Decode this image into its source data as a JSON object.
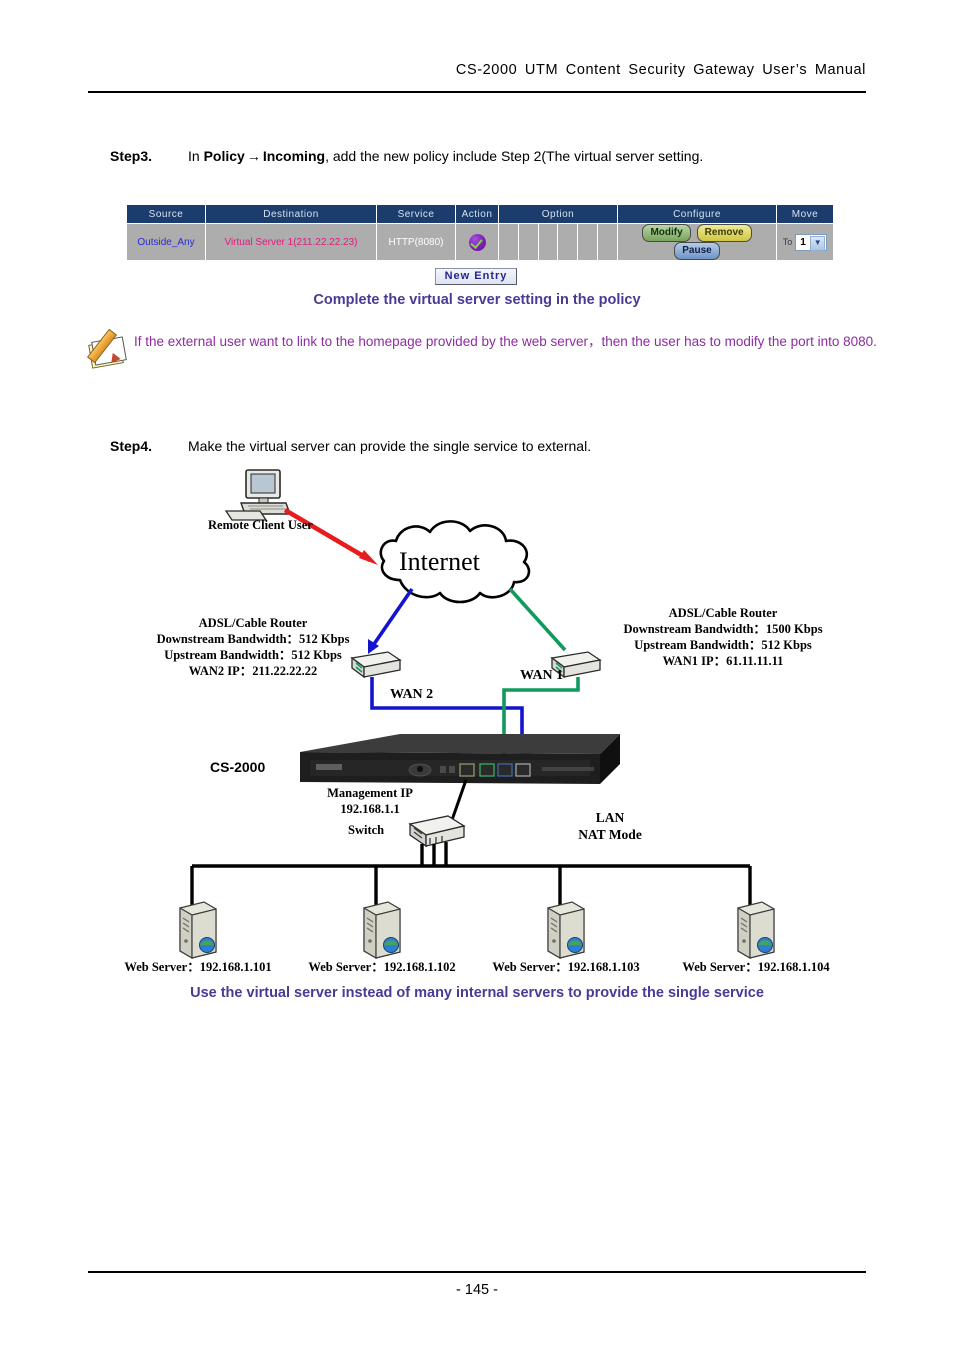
{
  "header": {
    "title": "CS-2000  UTM  Content  Security  Gateway  User’s  Manual"
  },
  "footer": {
    "page_number": "- 145 -"
  },
  "step3": {
    "label": "Step3.",
    "text_before": "In ",
    "bold1": "Policy",
    "arrow": "→",
    "bold2": "Incoming",
    "text_after": ", add the new policy include Step 2(The virtual server setting."
  },
  "step4": {
    "label": "Step4.",
    "text": "Make the virtual server can provide the single service to external."
  },
  "policy_table": {
    "columns": [
      "Source",
      "Destination",
      "Service",
      "Action",
      "Option",
      "Configure",
      "Move"
    ],
    "row": {
      "source": "Outside_Any",
      "destination": "Virtual Server 1(211.22.22.23)",
      "service": "HTTP(8080)",
      "action_icon": "permit-check-icon",
      "option_cells": [
        "",
        "",
        "",
        "",
        "",
        ""
      ],
      "configure": {
        "modify": "Modify",
        "remove": "Remove",
        "pause": "Pause"
      },
      "move": {
        "to_label": "To",
        "value": "1",
        "options": [
          "1"
        ]
      }
    },
    "colors": {
      "header_bg": "#1b3d6d",
      "header_text": "#d7e2ef",
      "row_bg": "#adadad",
      "source_text": "#2b2bd0",
      "destination_text": "#e6187f",
      "service_text": "#ffffff"
    }
  },
  "new_entry": {
    "label": "New  Entry"
  },
  "captions": {
    "policy": "Complete the virtual server setting in the policy",
    "diagram": "Use the virtual server instead of many internal servers to provide the single service",
    "color": "#4a3a96"
  },
  "note": {
    "icon": "pencil-notepad-icon",
    "text": "If the external user want to link to the homepage provided by the web server，then the user has to modify the port into 8080.",
    "color": "#8e2ca0"
  },
  "diagram": {
    "remote_client_label": "Remote Client User",
    "internet_label": "Internet",
    "router_left": {
      "title": "ADSL/Cable Router",
      "downstream": "Downstream Bandwidth：512 Kbps",
      "upstream": "Upstream Bandwidth：512 Kbps",
      "wan_ip": "WAN2 IP：211.22.22.22"
    },
    "router_right": {
      "title": "ADSL/Cable Router",
      "downstream": "Downstream Bandwidth：1500 Kbps",
      "upstream": "Upstream Bandwidth：512 Kbps",
      "wan_ip": "WAN1 IP：61.11.11.11"
    },
    "wan2_label": "WAN 2",
    "wan1_label": "WAN 1",
    "device_label": "CS-2000",
    "management_ip_label": "Management IP",
    "management_ip_value": "192.168.1.1",
    "switch_label": "Switch",
    "lan_label_line1": "LAN",
    "lan_label_line2": "NAT Mode",
    "servers": [
      {
        "label": "Web Server：192.168.1.101"
      },
      {
        "label": "Web Server：192.168.1.102"
      },
      {
        "label": "Web Server：192.168.1.103"
      },
      {
        "label": "Web Server：192.168.1.104"
      }
    ],
    "link_colors": {
      "client_to_internet": "#e81c1c",
      "wan2": "#1414cc",
      "wan1": "#0f9a5e",
      "lan": "#000000"
    }
  }
}
